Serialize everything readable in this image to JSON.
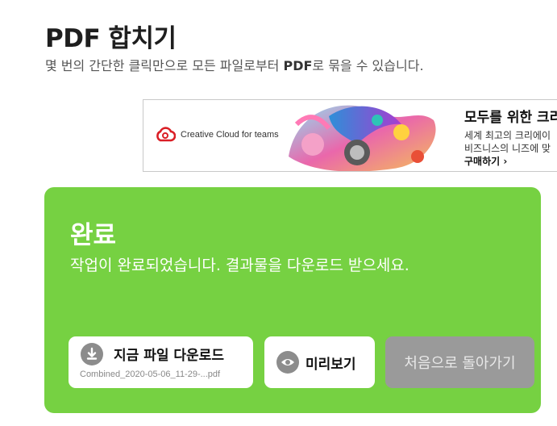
{
  "page": {
    "title": "PDF 합치기",
    "subtitle_pre": "몇 번의 간단한 클릭만으로 모든 파일로부터 ",
    "subtitle_bold": "PDF",
    "subtitle_post": "로 묶을 수 있습니다."
  },
  "ad": {
    "brand": "Creative Cloud for teams",
    "headline": "모두를 위한 크리",
    "line1": "세계 최고의 크리에이",
    "line2": "비즈니스의 니즈에 맞",
    "cta": "구매하기 ›"
  },
  "result": {
    "title": "완료",
    "message": "작업이 완료되었습니다. 결과물을 다운로드 받으세요.",
    "download_label": "지금 파일 다운로드",
    "download_filename": "Combined_2020-05-06_11-29-...pdf",
    "preview_label": "미리보기",
    "restart_label": "처음으로 돌아가기"
  },
  "colors": {
    "panel": "#76d142",
    "restart_button": "#9a9a9a",
    "adobe_red": "#da1f26"
  },
  "icons": {
    "download": "download-icon",
    "preview": "eye-icon",
    "brand": "creative-cloud-logo"
  }
}
